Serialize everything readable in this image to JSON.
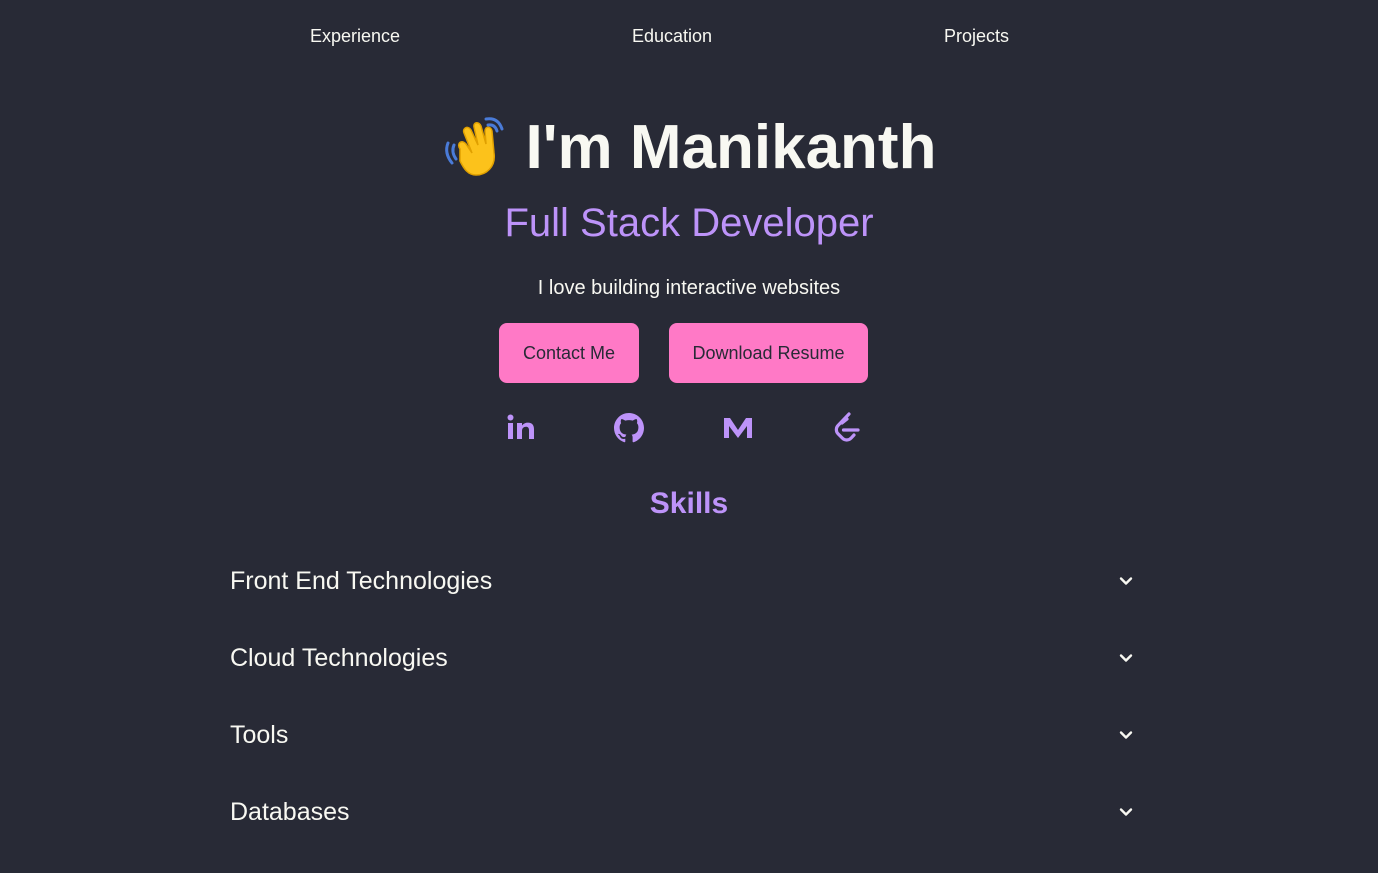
{
  "nav": {
    "items": [
      "Experience",
      "Education",
      "Projects"
    ]
  },
  "hero": {
    "wave_emoji": "👋",
    "title": "I'm Manikanth",
    "subtitle": "Full Stack Developer",
    "tagline": "I love building interactive websites",
    "contact_label": "Contact Me",
    "resume_label": "Download Resume"
  },
  "social": [
    {
      "icon": "linkedin-icon"
    },
    {
      "icon": "github-icon"
    },
    {
      "icon": "medium-icon"
    },
    {
      "icon": "leetcode-icon"
    }
  ],
  "skills": {
    "title": "Skills",
    "categories": [
      {
        "label": "Front End Technologies"
      },
      {
        "label": "Cloud Technologies"
      },
      {
        "label": "Tools"
      },
      {
        "label": "Databases"
      }
    ]
  },
  "colors": {
    "background": "#282a36",
    "text": "#f8f8f2",
    "accent_purple": "#bd93f9",
    "button_pink": "#ff79c6"
  }
}
